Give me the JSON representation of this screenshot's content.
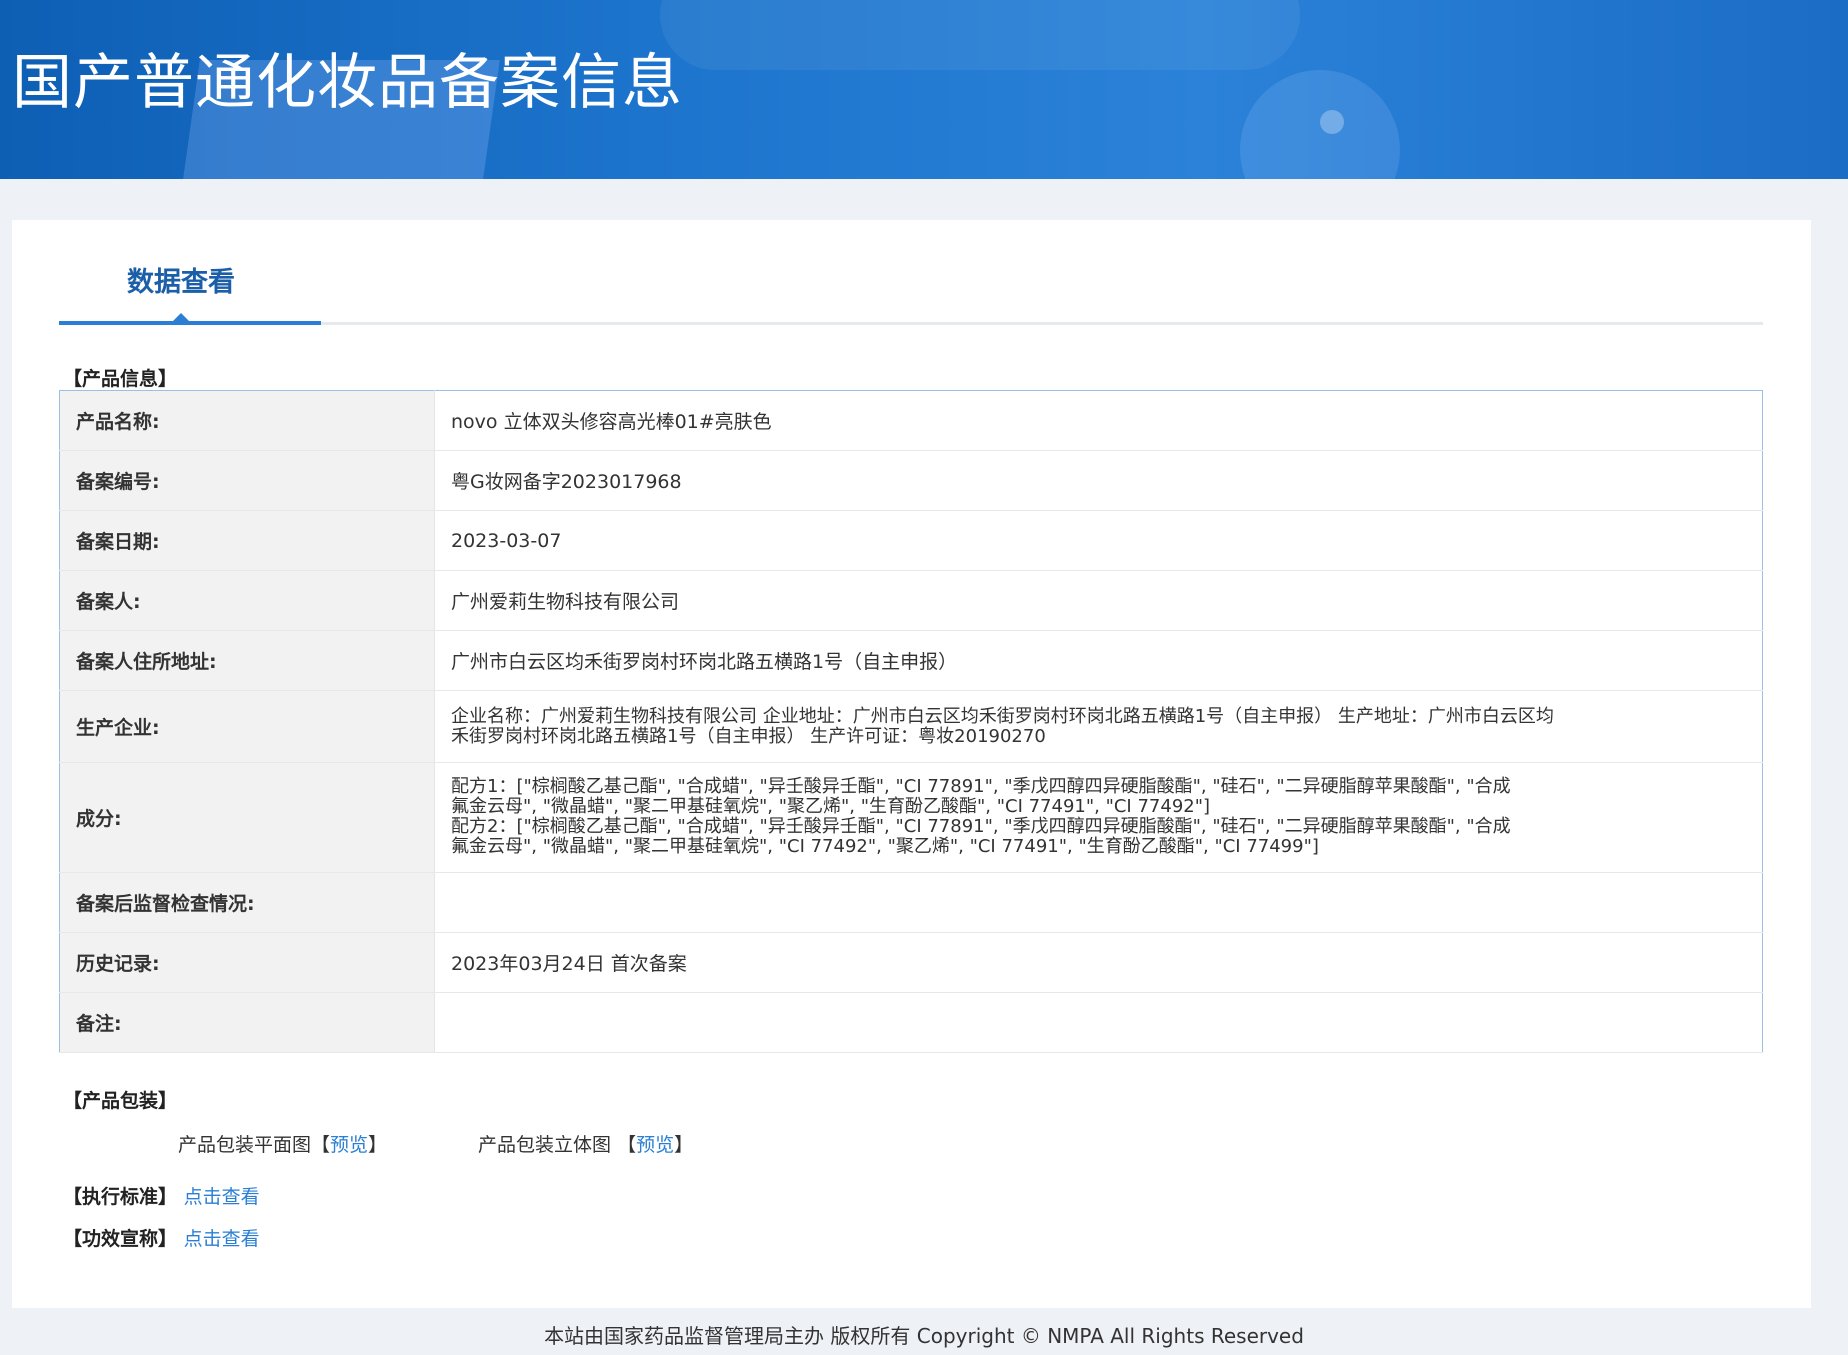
{
  "header": {
    "title": "国产普通化妆品备案信息"
  },
  "tabs": {
    "active_label": "数据查看"
  },
  "product_info": {
    "section_title": "【产品信息】",
    "rows": [
      {
        "label": "产品名称:",
        "value": "novo 立体双头修容高光棒01#亮肤色"
      },
      {
        "label": "备案编号:",
        "value": "粤G妆网备字2023017968"
      },
      {
        "label": "备案日期:",
        "value": "2023-03-07"
      },
      {
        "label": "备案人:",
        "value": "广州爱莉生物科技有限公司"
      },
      {
        "label": "备案人住所地址:",
        "value": "广州市白云区均禾街罗岗村环岗北路五横路1号（自主申报）"
      },
      {
        "label": "生产企业:",
        "value_lines": [
          "企业名称：广州爱莉生物科技有限公司 企业地址：广州市白云区均禾街罗岗村环岗北路五横路1号（自主申报） 生产地址：广州市白云区均",
          "禾街罗岗村环岗北路五横路1号（自主申报） 生产许可证：粤妆20190270"
        ]
      },
      {
        "label": "成分:",
        "value_lines": [
          "配方1：[\"棕榈酸乙基己酯\", \"合成蜡\", \"异壬酸异壬酯\", \"CI 77891\", \"季戊四醇四异硬脂酸酯\", \"硅石\", \"二异硬脂醇苹果酸酯\", \"合成",
          "氟金云母\", \"微晶蜡\", \"聚二甲基硅氧烷\", \"聚乙烯\", \"生育酚乙酸酯\", \"CI 77491\", \"CI 77492\"]",
          "配方2：[\"棕榈酸乙基己酯\", \"合成蜡\", \"异壬酸异壬酯\", \"CI 77891\", \"季戊四醇四异硬脂酸酯\", \"硅石\", \"二异硬脂醇苹果酸酯\", \"合成",
          "氟金云母\", \"微晶蜡\", \"聚二甲基硅氧烷\", \"CI 77492\", \"聚乙烯\", \"CI 77491\", \"生育酚乙酸酯\", \"CI 77499\"]"
        ]
      },
      {
        "label": "备案后监督检查情况:",
        "value": ""
      },
      {
        "label": "历史记录:",
        "value": "2023年03月24日 首次备案"
      },
      {
        "label": "备注:",
        "value": ""
      }
    ]
  },
  "packaging": {
    "section_title": "【产品包装】",
    "flat_label": "产品包装平面图",
    "solid_label": "产品包装立体图",
    "bracket_open": "【",
    "bracket_close": "】",
    "preview_link": "预览"
  },
  "standards": {
    "label": "【执行标准】",
    "link": "点击查看"
  },
  "efficacy": {
    "label": "【功效宣称】",
    "link": "点击查看"
  },
  "footer": {
    "text": "本站由国家药品监督管理局主办 版权所有 Copyright © NMPA All Rights Reserved"
  }
}
